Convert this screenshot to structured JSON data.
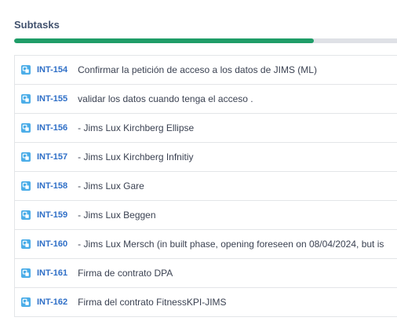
{
  "section": {
    "title": "Subtasks"
  },
  "progress": {
    "done_fraction": 0.782,
    "color_done": "#1f9d68",
    "color_todo": "#dfe1e6"
  },
  "subtasks": [
    {
      "key": "INT-154",
      "summary": "Confirmar la petición de acceso a los datos de JIMS (ML)",
      "icon": "subtask-icon"
    },
    {
      "key": "INT-155",
      "summary": "validar los datos cuando tenga el acceso .",
      "icon": "subtask-icon"
    },
    {
      "key": "INT-156",
      "summary": "- Jims Lux Kirchberg Ellipse",
      "icon": "subtask-icon"
    },
    {
      "key": "INT-157",
      "summary": "- Jims Lux Kirchberg Infnitiy",
      "icon": "subtask-icon"
    },
    {
      "key": "INT-158",
      "summary": "- Jims Lux Gare",
      "icon": "subtask-icon"
    },
    {
      "key": "INT-159",
      "summary": "- Jims Lux Beggen",
      "icon": "subtask-icon"
    },
    {
      "key": "INT-160",
      "summary": "- Jims Lux Mersch (in built phase, opening foreseen on 08/04/2024, but is",
      "icon": "subtask-icon"
    },
    {
      "key": "INT-161",
      "summary": "Firma de contrato DPA",
      "icon": "subtask-icon"
    },
    {
      "key": "INT-162",
      "summary": "Firma del contrato FitnessKPI-JIMS",
      "icon": "subtask-icon"
    }
  ]
}
